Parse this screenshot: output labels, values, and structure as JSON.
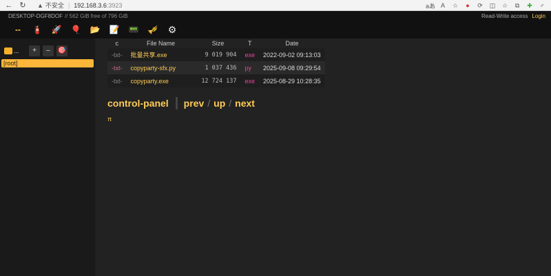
{
  "browser": {
    "back": "←",
    "reload": "↻",
    "warn": "▲",
    "insecure": "不安全",
    "url_host": "192.168.3.6",
    "url_port": ":3923",
    "icons": [
      "aあ",
      "A",
      "☆",
      "●",
      "⟳",
      "◫",
      "☆",
      "⧉",
      "✚",
      "♂"
    ]
  },
  "topbar": {
    "host": "DESKTOP-DGF8DOF",
    "free": "// 562 GiB free of 796 GiB",
    "access": "Read-Write access",
    "login": "Login"
  },
  "toolbar": {
    "items": [
      {
        "name": "dash-icon",
        "glyph": "--"
      },
      {
        "name": "extinguisher-icon",
        "glyph": "🧯"
      },
      {
        "name": "rocket-icon",
        "glyph": "🚀"
      },
      {
        "name": "pin-icon",
        "glyph": "🎈"
      },
      {
        "name": "folder-icon",
        "glyph": "📂"
      },
      {
        "name": "note-icon",
        "glyph": "📝"
      },
      {
        "name": "keyboard-icon",
        "glyph": "📟"
      },
      {
        "name": "paint-icon",
        "glyph": "🎺"
      },
      {
        "name": "gear-icon",
        "glyph": "⚙"
      }
    ]
  },
  "sidebar": {
    "dots": "...",
    "plus": "+",
    "minus": "–",
    "target": "🎯",
    "root": "[root]"
  },
  "table": {
    "headers": [
      "c",
      "File Name",
      "Size",
      "T",
      "Date"
    ],
    "rows": [
      {
        "c": "-txt-",
        "name": "批量共享.exe",
        "size": "9 019 904",
        "ext": "exe",
        "date": "2022-09-02 09:13:03"
      },
      {
        "c": "-txt-",
        "name": "copyparty-sfx.py",
        "size": "1 037 436",
        "ext": "py",
        "date": "2025-09-08 09:29:54"
      },
      {
        "c": "-txt-",
        "name": "copyparty.exe",
        "size": "12 724 137",
        "ext": "exe",
        "date": "2025-08-29 10:28:35"
      }
    ]
  },
  "nav": {
    "control_panel": "control-panel",
    "prev": "prev",
    "up": "up",
    "next": "next",
    "sep": "/"
  },
  "pi": "π",
  "colors": {
    "accent": "#ffcc55",
    "ext": "#e04a9a",
    "background": "#222222"
  }
}
